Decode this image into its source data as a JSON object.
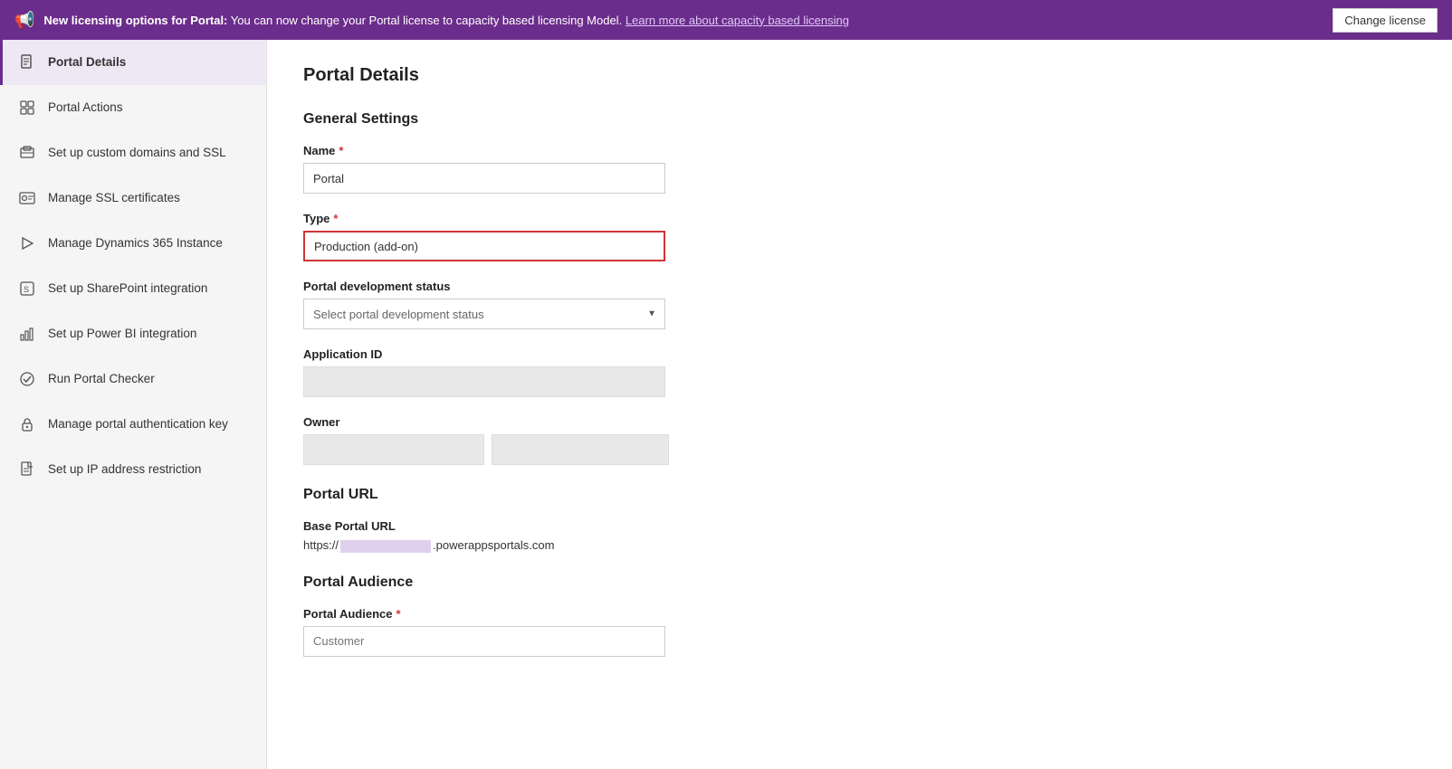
{
  "banner": {
    "icon": "📢",
    "text_bold": "New licensing options for Portal:",
    "text_normal": " You can now change your Portal license to capacity based licensing Model.",
    "link_text": "Learn more about capacity based licensing",
    "button_label": "Change license"
  },
  "sidebar": {
    "items": [
      {
        "id": "portal-details",
        "label": "Portal Details",
        "icon": "doc",
        "active": true
      },
      {
        "id": "portal-actions",
        "label": "Portal Actions",
        "icon": "grid"
      },
      {
        "id": "custom-domains",
        "label": "Set up custom domains and SSL",
        "icon": "domains"
      },
      {
        "id": "ssl-certs",
        "label": "Manage SSL certificates",
        "icon": "cert"
      },
      {
        "id": "dynamics",
        "label": "Manage Dynamics 365 Instance",
        "icon": "play"
      },
      {
        "id": "sharepoint",
        "label": "Set up SharePoint integration",
        "icon": "sharepoint"
      },
      {
        "id": "powerbi",
        "label": "Set up Power BI integration",
        "icon": "chart"
      },
      {
        "id": "portal-checker",
        "label": "Run Portal Checker",
        "icon": "checker"
      },
      {
        "id": "auth-key",
        "label": "Manage portal authentication key",
        "icon": "lock"
      },
      {
        "id": "ip-restriction",
        "label": "Set up IP address restriction",
        "icon": "file"
      }
    ]
  },
  "main": {
    "page_title": "Portal Details",
    "general_settings": {
      "title": "General Settings",
      "name_label": "Name",
      "name_required": "*",
      "name_value": "Portal",
      "type_label": "Type",
      "type_required": "*",
      "type_value": "Production (add-on)",
      "dev_status_label": "Portal development status",
      "dev_status_placeholder": "Select portal development status",
      "app_id_label": "Application ID",
      "owner_label": "Owner"
    },
    "portal_url": {
      "title": "Portal URL",
      "base_url_label": "Base Portal URL",
      "base_url_prefix": "https://",
      "base_url_suffix": ".powerappsportals.com"
    },
    "portal_audience": {
      "title": "Portal Audience",
      "label": "Portal Audience",
      "required": "*",
      "placeholder": "Customer"
    }
  }
}
